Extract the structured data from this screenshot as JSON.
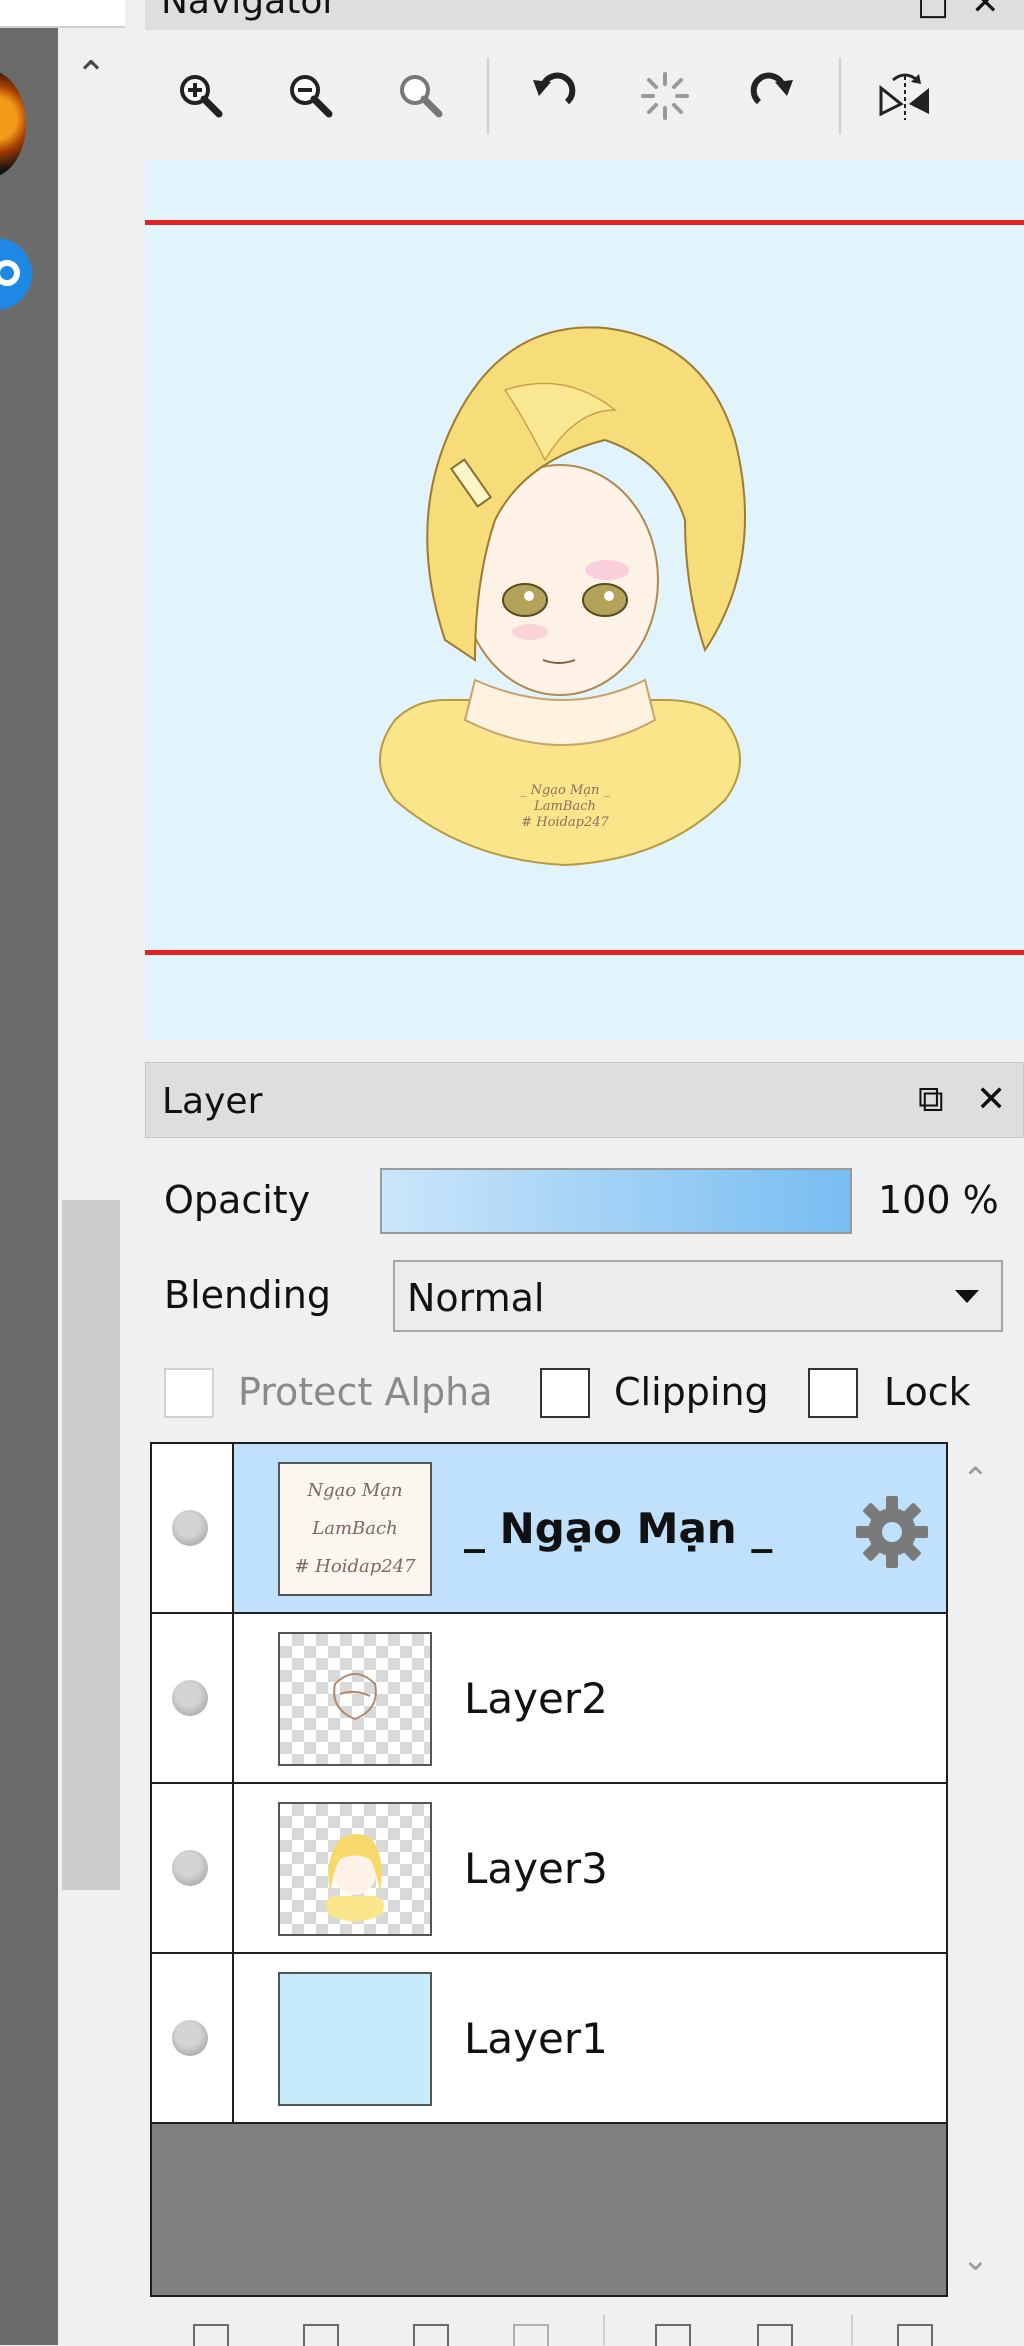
{
  "navigator": {
    "title": "Navigator",
    "toolbar": {
      "icons": [
        "zoom-in-icon",
        "zoom-out-icon",
        "zoom-reset-icon",
        "rotate-left-icon",
        "rotate-reset-icon",
        "rotate-right-icon",
        "flip-horizontal-icon"
      ]
    },
    "canvas_background": "#e1f4fb",
    "view_frame_color": "#e32222"
  },
  "layer_panel": {
    "title": "Layer",
    "opacity": {
      "label": "Opacity",
      "value": "100 %",
      "fraction": 1.0
    },
    "blending": {
      "label": "Blending",
      "value": "Normal"
    },
    "checkboxes": {
      "protect_alpha": {
        "label": "Protect Alpha",
        "checked": false,
        "enabled": false
      },
      "clipping": {
        "label": "Clipping",
        "checked": false
      },
      "lock": {
        "label": "Lock",
        "checked": false
      }
    },
    "layers": [
      {
        "name": "_ Ngạo Mạn _",
        "selected": true,
        "thumb_text": "Ngạo Mạn\nLamBach\n# Hoidap247"
      },
      {
        "name": "Layer2",
        "selected": false
      },
      {
        "name": "Layer3",
        "selected": false
      },
      {
        "name": "Layer1",
        "selected": false
      }
    ],
    "selected_color": "#c0e1fb"
  },
  "colors": {
    "sidebar_dark": "#6b6b6b",
    "panel_bg": "#f0f0f0",
    "title_bar": "#dedede"
  }
}
